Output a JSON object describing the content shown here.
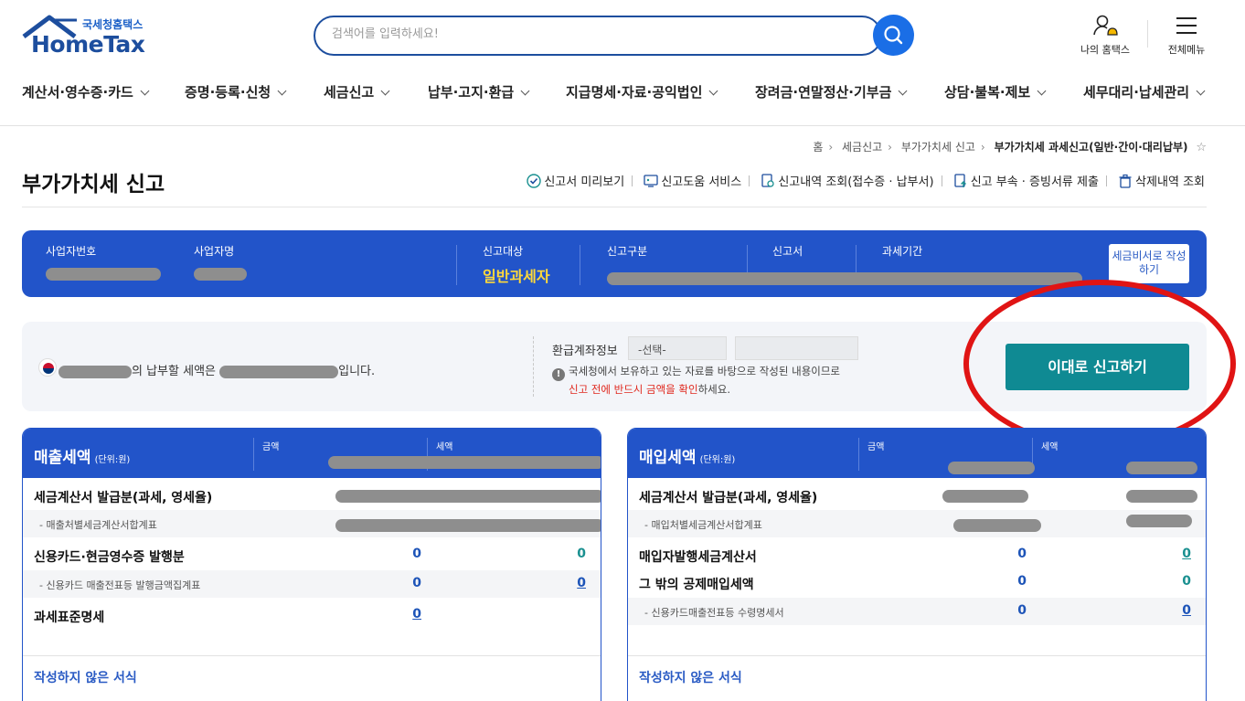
{
  "header": {
    "logo_sub": "국세청홈택스",
    "logo_main": "HomeTax",
    "search_placeholder": "검색어를 입력하세요!",
    "my_hometax": "나의 홈택스",
    "all_menu": "전체메뉴"
  },
  "nav": [
    {
      "label": "계산서·영수증·카드"
    },
    {
      "label": "증명·등록·신청"
    },
    {
      "label": "세금신고"
    },
    {
      "label": "납부·고지·환급"
    },
    {
      "label": "지급명세·자료·공익법인"
    },
    {
      "label": "장려금·연말정산·기부금"
    },
    {
      "label": "상담·불복·제보"
    },
    {
      "label": "세무대리·납세관리"
    }
  ],
  "breadcrumb": [
    "홈",
    "세금신고",
    "부가가치세 신고",
    "부가가치세 과세신고(일반·간이·대리납부)"
  ],
  "page_title": "부가가치세 신고",
  "tools": [
    "신고서 미리보기",
    "신고도움 서비스",
    "신고내역 조회(접수증 · 납부서)",
    "신고 부속 · 증빙서류 제출",
    "삭제내역 조회"
  ],
  "infobar": {
    "biz_no_label": "사업자번호",
    "biz_name_label": "사업자명",
    "target_label": "신고대상",
    "target_value": "일반과세자",
    "type_label": "신고구분",
    "form_label": "신고서",
    "period_label": "과세기간",
    "tax_secretary_btn": "세금비서로 작성하기"
  },
  "summary": {
    "msg_mid": "의 납부할 세액은",
    "msg_end": "입니다.",
    "refund_label": "환급계좌정보",
    "refund_select": "-선택-",
    "notice1": "국세청에서 보유하고 있는 자료를 바탕으로 작성된 내용이므로",
    "notice2_red": "신고 전에 반드시 금액을 확인",
    "notice2_end": "하세요.",
    "file_button": "이대로 신고하기"
  },
  "sales": {
    "title": "매출세액",
    "unit": "(단위:원)",
    "col_amount": "금액",
    "col_tax": "세액",
    "rows": [
      {
        "label": "세금계산서 발급분(과세, 영세율)",
        "sub": false,
        "amount": "",
        "tax": ""
      },
      {
        "label": "- 매출처별세금계산서합계표",
        "sub": true,
        "amount": "",
        "tax": ""
      },
      {
        "label": "신용카드·현금영수증 발행분",
        "sub": false,
        "amount": "0",
        "tax": "0"
      },
      {
        "label": "- 신용카드 매출전표등 발행금액집계표",
        "sub": true,
        "amount": "0",
        "tax": "0"
      },
      {
        "label": "과세표준명세",
        "sub": false,
        "amount": "0",
        "tax": ""
      }
    ],
    "unwritten": "작성하지 않은 서식"
  },
  "purchase": {
    "title": "매입세액",
    "unit": "(단위:원)",
    "col_amount": "금액",
    "col_tax": "세액",
    "rows": [
      {
        "label": "세금계산서 발급분(과세, 영세율)",
        "sub": false,
        "amount": "",
        "tax": ""
      },
      {
        "label": "- 매입처별세금계산서합계표",
        "sub": true,
        "amount": "",
        "tax": ""
      },
      {
        "label": "매입자발행세금계산서",
        "sub": false,
        "amount": "0",
        "tax": "0"
      },
      {
        "label": "그 밖의 공제매입세액",
        "sub": false,
        "amount": "0",
        "tax": "0"
      },
      {
        "label": "- 신용카드매출전표등 수령명세서",
        "sub": true,
        "amount": "0",
        "tax": "0"
      }
    ],
    "unwritten": "작성하지 않은 서식"
  }
}
